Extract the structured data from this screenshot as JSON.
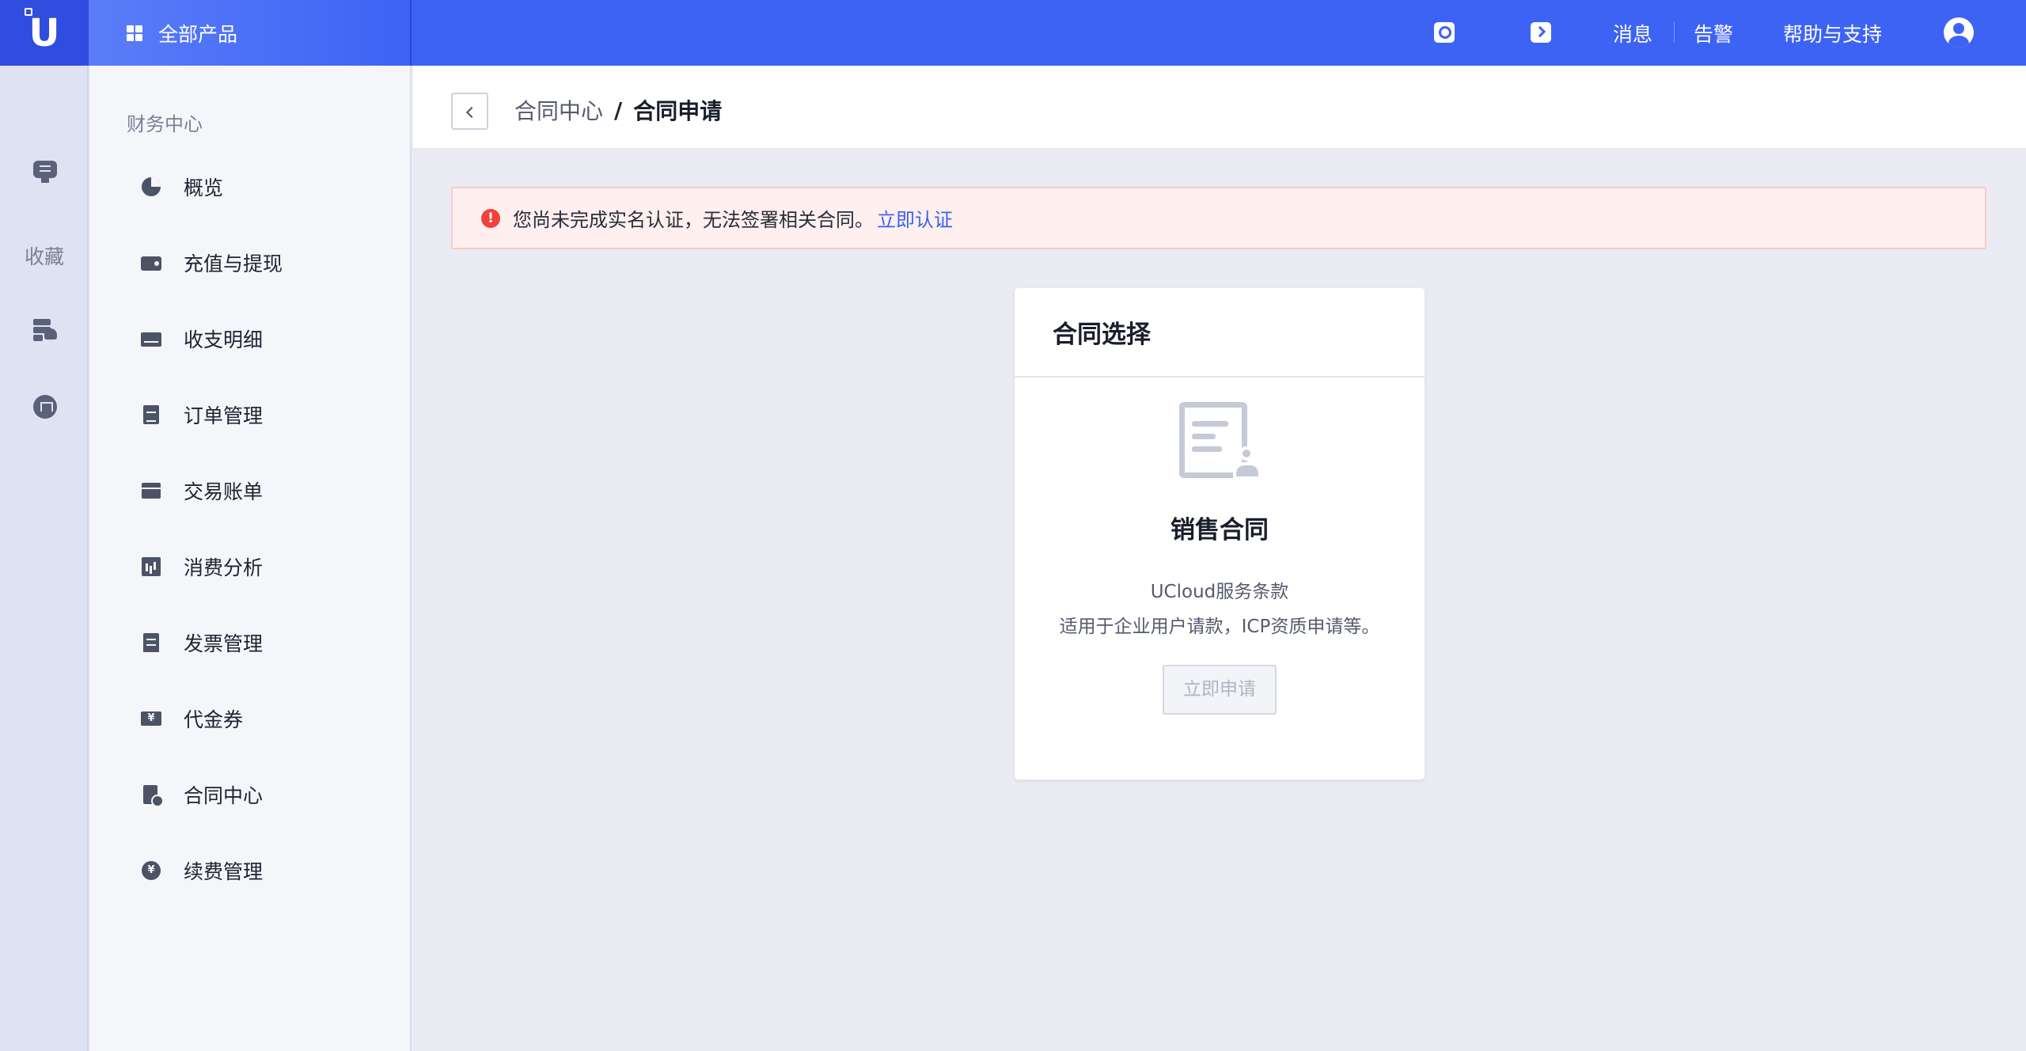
{
  "topbar": {
    "all_products_label": "全部产品",
    "messages_label": "消息",
    "alarms_label": "告警",
    "help_label": "帮助与支持"
  },
  "rail": {
    "favorites_label": "收藏"
  },
  "sidebar": {
    "section_title": "财务中心",
    "items": [
      {
        "label": "概览",
        "icon": "pie-chart-icon"
      },
      {
        "label": "充值与提现",
        "icon": "wallet-icon"
      },
      {
        "label": "收支明细",
        "icon": "card-icon"
      },
      {
        "label": "订单管理",
        "icon": "document-icon"
      },
      {
        "label": "交易账单",
        "icon": "bill-icon"
      },
      {
        "label": "消费分析",
        "icon": "bar-chart-icon"
      },
      {
        "label": "发票管理",
        "icon": "invoice-icon"
      },
      {
        "label": "代金券",
        "icon": "coupon-icon"
      },
      {
        "label": "合同中心",
        "icon": "contract-icon"
      },
      {
        "label": "续费管理",
        "icon": "renew-icon"
      }
    ]
  },
  "breadcrumb": {
    "parent": "合同中心",
    "separator": "/",
    "current": "合同申请"
  },
  "alert": {
    "message": "您尚未完成实名认证，无法签署相关合同。",
    "link_text": "立即认证"
  },
  "card": {
    "header": "合同选择",
    "title": "销售合同",
    "desc_line1": "UCloud服务条款",
    "desc_line2": "适用于企业用户请款，ICP资质申请等。",
    "button_label": "立即申请"
  },
  "colors": {
    "brand_blue": "#3d63f5",
    "alert_red": "#f2403b",
    "link_blue": "#3a62f2"
  }
}
